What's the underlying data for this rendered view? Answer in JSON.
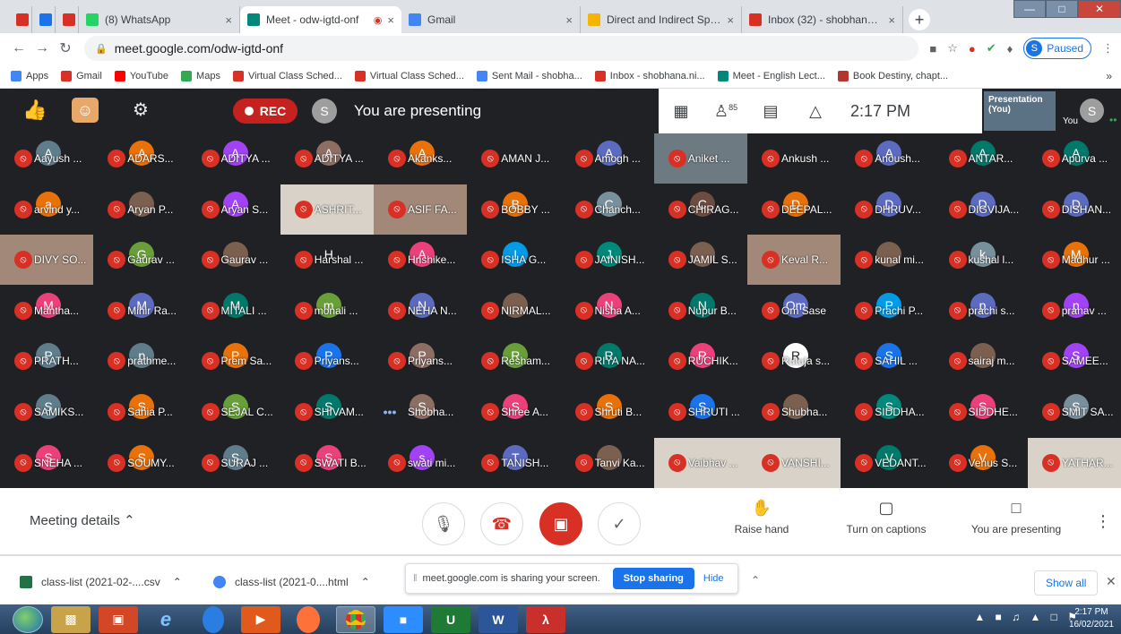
{
  "browser": {
    "tabs": [
      {
        "label": "",
        "icon": "nkh-icon",
        "color": "#d93025"
      },
      {
        "label": "",
        "icon": "info-icon",
        "color": "#1a73e8"
      },
      {
        "label": "",
        "icon": "gmail-icon",
        "color": "#d93025"
      },
      {
        "label": "(8) WhatsApp",
        "icon": "whatsapp-icon",
        "color": "#25d366"
      },
      {
        "label": "Meet - odw-igtd-onf",
        "icon": "meet-icon",
        "color": "#00897b",
        "active": true
      },
      {
        "label": "Gmail",
        "icon": "google-icon",
        "color": "#4285f4"
      },
      {
        "label": "Direct and Indirect Speech",
        "icon": "doc-icon",
        "color": "#f4b400"
      },
      {
        "label": "Inbox (32) - shobhananikan",
        "icon": "gmail-icon",
        "color": "#d93025"
      }
    ],
    "url": "meet.google.com/odw-igtd-onf",
    "profile_initial": "S",
    "profile_status": "Paused",
    "bookmarks": [
      {
        "label": "Apps",
        "color": "#4285f4"
      },
      {
        "label": "Gmail",
        "color": "#d93025"
      },
      {
        "label": "YouTube",
        "color": "#ff0000"
      },
      {
        "label": "Maps",
        "color": "#34a853"
      },
      {
        "label": "Virtual Class Sched...",
        "color": "#d93025"
      },
      {
        "label": "Virtual Class Sched...",
        "color": "#d93025"
      },
      {
        "label": "Sent Mail - shobha...",
        "color": "#4285f4"
      },
      {
        "label": "Inbox - shobhana.ni...",
        "color": "#d93025"
      },
      {
        "label": "Meet - English Lect...",
        "color": "#00897b"
      },
      {
        "label": "Book Destiny, chapt...",
        "color": "#b5342c"
      }
    ],
    "bookmarks_more": "»"
  },
  "meet": {
    "rec_label": "REC",
    "presenter_initial": "S",
    "presenting_text": "You are presenting",
    "people_count": "85",
    "time": "2:17 PM",
    "presentation_label": "Presentation (You)",
    "you_label": "You",
    "you_initial": "S"
  },
  "participants": [
    [
      "A",
      "Aayush ...",
      "#607d8b"
    ],
    [
      "A",
      "ADARS...",
      "#e8710a"
    ],
    [
      "A",
      "ADITYA ...",
      "#a142f4"
    ],
    [
      "A",
      "ADITYA ...",
      "#8d6e63"
    ],
    [
      "A",
      "Akanks...",
      "#e8710a"
    ],
    [
      "",
      "AMAN J...",
      "#202124"
    ],
    [
      "A",
      "Amogh ...",
      "#5c6bc0"
    ],
    [
      "",
      "Aniket ...",
      "video"
    ],
    [
      "",
      "Ankush ...",
      "#202124"
    ],
    [
      "A",
      "Anoush...",
      "#5c6bc0"
    ],
    [
      "A",
      "ANTAR...",
      "#00796b"
    ],
    [
      "A",
      "Apurva ...",
      "#00796b"
    ],
    [
      "a",
      "arvind y...",
      "#e8710a"
    ],
    [
      "",
      "Aryan P...",
      "photo"
    ],
    [
      "A",
      "Aryan S...",
      "#a142f4"
    ],
    [
      "",
      "ASHRIT...",
      "video-light"
    ],
    [
      "",
      "ASIF FA...",
      "video-warm"
    ],
    [
      "B",
      "BOBBY ...",
      "#e8710a"
    ],
    [
      "C",
      "Chanch...",
      "#78909c"
    ],
    [
      "C",
      "CHIRAG...",
      "#6d4c41"
    ],
    [
      "D",
      "DEEPAL...",
      "#e8710a"
    ],
    [
      "D",
      "DHRUV...",
      "#5c6bc0"
    ],
    [
      "D",
      "DIGVIJA...",
      "#5c6bc0"
    ],
    [
      "D",
      "DISHAN...",
      "#5c6bc0"
    ],
    [
      "",
      "DIVY SO...",
      "video-warm"
    ],
    [
      "G",
      "Gaurav ...",
      "#689f38"
    ],
    [
      "",
      "Gaurav ...",
      "photo"
    ],
    [
      "H",
      "Harshal ...",
      "#202124"
    ],
    [
      "A",
      "Hrishike...",
      "#ec407a"
    ],
    [
      "I",
      "ISHA G...",
      "#039be5"
    ],
    [
      "J",
      "JAINISH...",
      "#00897b"
    ],
    [
      "",
      "JAMIL S...",
      "photo"
    ],
    [
      "",
      "Keval R...",
      "video-warm"
    ],
    [
      "",
      "kunal mi...",
      "photo"
    ],
    [
      "k",
      "kushal l...",
      "#78909c"
    ],
    [
      "M",
      "Madhur ...",
      "#e8710a"
    ],
    [
      "M",
      "Mantha...",
      "#ec407a"
    ],
    [
      "M",
      "Mihir Ra...",
      "#5c6bc0"
    ],
    [
      "M",
      "MITALI ...",
      "#00796b"
    ],
    [
      "m",
      "monali ...",
      "#689f38"
    ],
    [
      "N",
      "NEHA N...",
      "#5c6bc0"
    ],
    [
      "",
      "NIRMAL...",
      "photo"
    ],
    [
      "N",
      "Nisha A...",
      "#ec407a"
    ],
    [
      "N",
      "Nupur B...",
      "#00796b"
    ],
    [
      "Om",
      "Om Sase",
      "#5c6bc0"
    ],
    [
      "P",
      "Prachi P...",
      "#039be5"
    ],
    [
      "p",
      "prachi s...",
      "#5c6bc0"
    ],
    [
      "p",
      "pranav ...",
      "#a142f4"
    ],
    [
      "P",
      "PRATH...",
      "#607d8b"
    ],
    [
      "p",
      "prathme...",
      "#607d8b"
    ],
    [
      "P",
      "Prem Sa...",
      "#e8710a"
    ],
    [
      "P",
      "Priyans...",
      "#1a73e8"
    ],
    [
      "P",
      "Priyans...",
      "#8d6e63"
    ],
    [
      "R",
      "Resham...",
      "#689f38"
    ],
    [
      "R",
      "RIYA NA...",
      "#00796b"
    ],
    [
      "R",
      "RUCHIK...",
      "#ec407a"
    ],
    [
      "R",
      "Rutuja s...",
      "#ffffff"
    ],
    [
      "S",
      "SAHIL ...",
      "#1a73e8"
    ],
    [
      "",
      "sairaj m...",
      "photo"
    ],
    [
      "S",
      "SAMEE...",
      "#a142f4"
    ],
    [
      "S",
      "SAMIKS...",
      "#607d8b"
    ],
    [
      "S",
      "Sahia P...",
      "#e8710a"
    ],
    [
      "S",
      "SEJAL C...",
      "#689f38"
    ],
    [
      "S",
      "SHIVAM...",
      "#00796b"
    ],
    [
      "S",
      "Shobha...",
      "#8d6e63"
    ],
    [
      "S",
      "Shree A...",
      "#ec407a"
    ],
    [
      "S",
      "Shruti B...",
      "#e8710a"
    ],
    [
      "S",
      "SHRUTI ...",
      "#1a73e8"
    ],
    [
      "",
      "Shubha...",
      "photo"
    ],
    [
      "S",
      "SIDDHA...",
      "#00897b"
    ],
    [
      "S",
      "SIDDHE...",
      "#ec407a"
    ],
    [
      "S",
      "SMIT SA...",
      "#78909c"
    ],
    [
      "S",
      "SNEHA ...",
      "#ec407a"
    ],
    [
      "S",
      "SOUMY...",
      "#e8710a"
    ],
    [
      "S",
      "SURAJ ...",
      "#607d8b"
    ],
    [
      "S",
      "SWATI B...",
      "#ec407a"
    ],
    [
      "s",
      "swati mi...",
      "#a142f4"
    ],
    [
      "T",
      "TANISH...",
      "#5c6bc0"
    ],
    [
      "",
      "Tanvi Ka...",
      "photo"
    ],
    [
      "",
      "Vaibhav ...",
      "video-light"
    ],
    [
      "",
      "VANSHI...",
      "video-light"
    ],
    [
      "V",
      "VEDANT...",
      "#00796b"
    ],
    [
      "V",
      "Venus S...",
      "#e8710a"
    ],
    [
      "",
      "YATHAR...",
      "video-light"
    ]
  ],
  "controls": {
    "meeting_details": "Meeting details",
    "raise_hand": "Raise hand",
    "captions": "Turn on captions",
    "you_are_presenting": "You are presenting"
  },
  "downloads": {
    "file1": "class-list (2021-02-....csv",
    "file2": "class-list (2021-0....html",
    "share_text": "meet.google.com is sharing your screen.",
    "stop_sharing": "Stop sharing",
    "hide": "Hide",
    "show_all": "Show all"
  },
  "taskbar": {
    "time": "2:17 PM",
    "date": "16/02/2021"
  }
}
